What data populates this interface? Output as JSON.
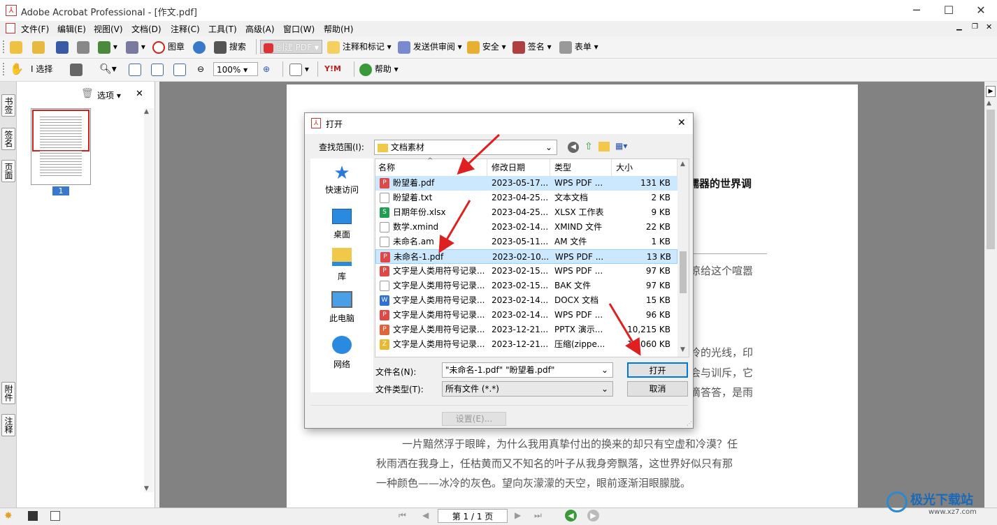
{
  "app": {
    "title": "Adobe Acrobat Professional - [作文.pdf]"
  },
  "menu": [
    "文件(F)",
    "编辑(E)",
    "视图(V)",
    "文档(D)",
    "注释(C)",
    "工具(T)",
    "高级(A)",
    "窗口(W)",
    "帮助(H)"
  ],
  "toolbar1": {
    "stamp": "图章",
    "search": "搜索",
    "create_pdf": "创建 PDF",
    "comment_markup": "注释和标记",
    "send_review": "发送供审阅",
    "security": "安全",
    "sign": "签名",
    "forms": "表单"
  },
  "toolbar2": {
    "select": "选择",
    "zoom": "100%",
    "help": "帮助"
  },
  "left_tabs": {
    "bookmarks": "书签",
    "signatures": "签名",
    "pages": "页面",
    "attachments": "附件",
    "comments": "注释"
  },
  "thumb_panel": {
    "options": "选项",
    "page_number": "1"
  },
  "document": {
    "heading_fragment": "嚅器的世界调",
    "line1_fragment": "凉给这个喧嚣",
    "line2_fragment": "冷的光线，印",
    "line3_fragment": "会与训斥，它",
    "line4_fragment": "滴答答，是雨",
    "para1": "一片黯然浮于眼眸，为什么我用真挚付出的换来的却只有空虚和冷漠？任",
    "para2": "秋雨洒在我身上，任枯黄而又不知名的叶子从我身旁飘落，这世界好似只有那",
    "para3": "一种颜色——冰冷的灰色。望向灰濛濛的天空，眼前逐渐泪眼朦胧。"
  },
  "status": {
    "page_indicator": "第 1 / 1 页"
  },
  "dialog": {
    "title": "打开",
    "look_in_label": "查找范围(I):",
    "look_in_value": "文档素材",
    "places": [
      "快速访问",
      "桌面",
      "库",
      "此电脑",
      "网络"
    ],
    "columns": [
      "名称",
      "修改日期",
      "类型",
      "大小"
    ],
    "files": [
      {
        "name": "盼望着.pdf",
        "date": "2023-05-17...",
        "type": "WPS PDF ...",
        "size": "131 KB",
        "icon": "pdf"
      },
      {
        "name": "盼望着.txt",
        "date": "2023-04-25...",
        "type": "文本文档",
        "size": "2 KB",
        "icon": "txt"
      },
      {
        "name": "日期年份.xlsx",
        "date": "2023-04-25...",
        "type": "XLSX 工作表",
        "size": "9 KB",
        "icon": "xlsx"
      },
      {
        "name": "数学.xmind",
        "date": "2023-02-14...",
        "type": "XMIND 文件",
        "size": "22 KB",
        "icon": "txt"
      },
      {
        "name": "未命名.am",
        "date": "2023-05-11...",
        "type": "AM 文件",
        "size": "1 KB",
        "icon": "txt"
      },
      {
        "name": "未命名-1.pdf",
        "date": "2023-02-10...",
        "type": "WPS PDF ...",
        "size": "13 KB",
        "icon": "pdf"
      },
      {
        "name": "文字是人类用符号记录...",
        "date": "2023-02-15...",
        "type": "WPS PDF ...",
        "size": "97 KB",
        "icon": "pdf"
      },
      {
        "name": "文字是人类用符号记录...",
        "date": "2023-02-15...",
        "type": "BAK 文件",
        "size": "97 KB",
        "icon": "txt"
      },
      {
        "name": "文字是人类用符号记录...",
        "date": "2023-02-14...",
        "type": "DOCX 文档",
        "size": "15 KB",
        "icon": "docx"
      },
      {
        "name": "文字是人类用符号记录...",
        "date": "2023-02-14...",
        "type": "WPS PDF ...",
        "size": "96 KB",
        "icon": "pdf"
      },
      {
        "name": "文字是人类用符号记录...",
        "date": "2023-12-21...",
        "type": "PPTX 演示...",
        "size": "10,215 KB",
        "icon": "pptx"
      },
      {
        "name": "文字是人类用符号记录...",
        "date": "2023-12-21...",
        "type": "压缩(zippe...",
        "size": "10,060 KB",
        "icon": "zip"
      }
    ],
    "filename_label": "文件名(N):",
    "filename_value": "\"未命名-1.pdf\" \"盼望着.pdf\"",
    "filetype_label": "文件类型(T):",
    "filetype_value": "所有文件 (*.*)",
    "open_button": "打开",
    "cancel_button": "取消",
    "settings_button": "设置(E)..."
  },
  "watermark": {
    "text": "极光下载站",
    "url": "www.xz7.com"
  },
  "colors": {
    "pdf": "#e04848",
    "xlsx": "#1e9e50",
    "docx": "#2f6fd6",
    "pptx": "#e0633a",
    "zip": "#e8b830",
    "txt": "#ffffff",
    "arrow": "#e02020",
    "selection": "#cce8ff"
  }
}
